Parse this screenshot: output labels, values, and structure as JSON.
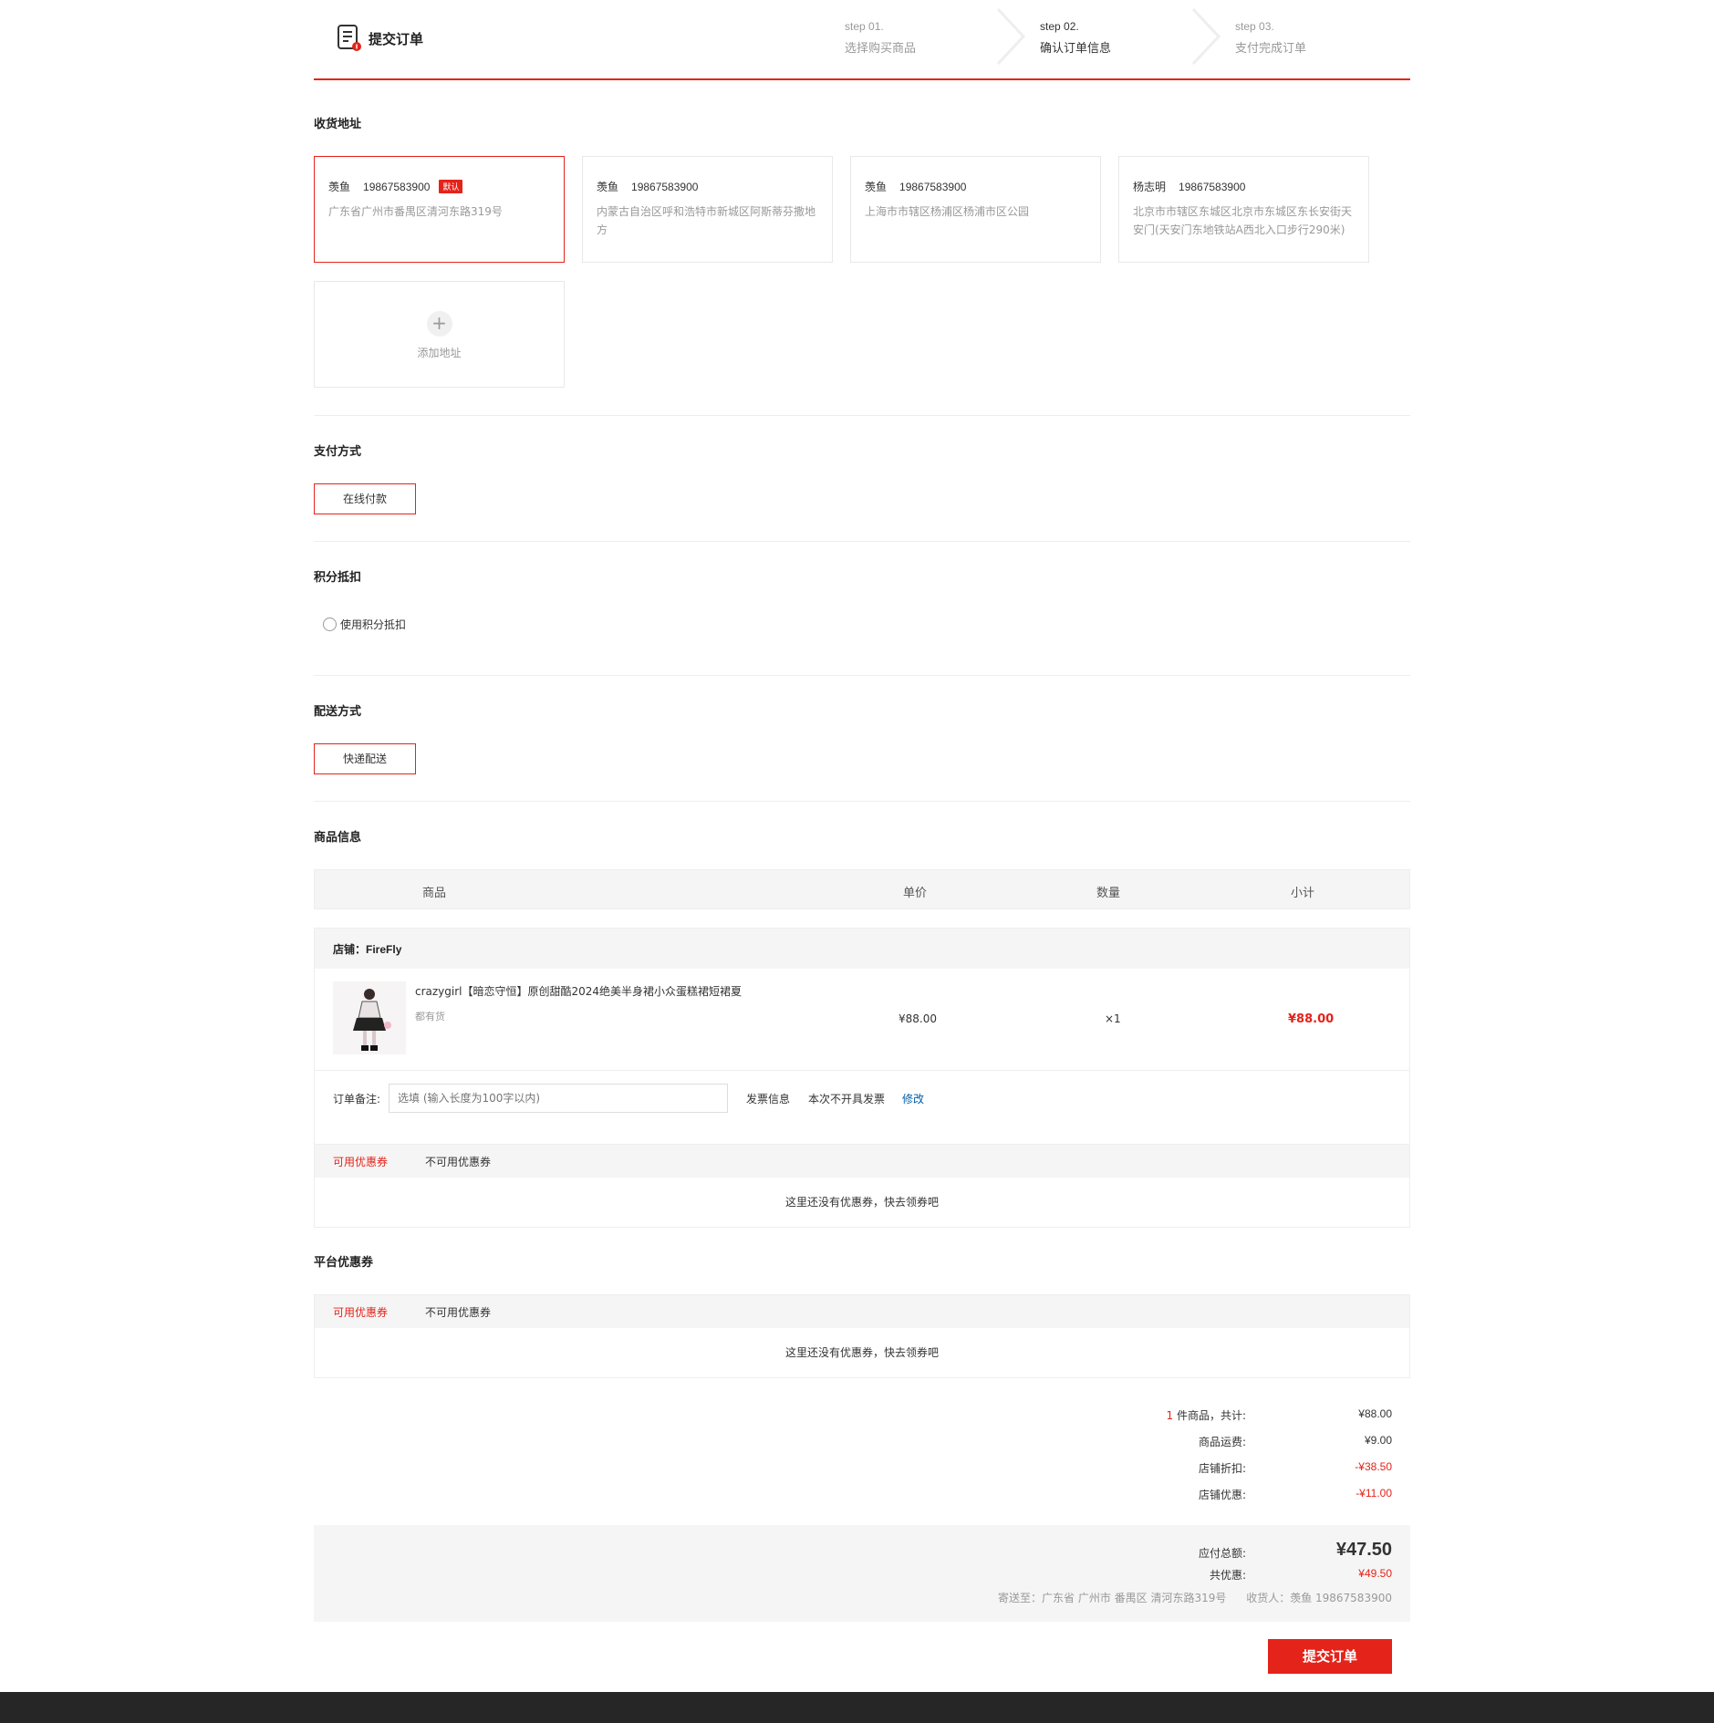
{
  "header": {
    "title": "提交订单",
    "steps": [
      {
        "num": "step 01.",
        "name": "选择购买商品"
      },
      {
        "num": "step 02.",
        "name": "确认订单信息"
      },
      {
        "num": "step 03.",
        "name": "支付完成订单"
      }
    ]
  },
  "address": {
    "title": "收货地址",
    "default_badge": "默认",
    "add_label": "添加地址",
    "cards": [
      {
        "name": "羡鱼",
        "phone": "19867583900",
        "detail": "广东省广州市番禺区清河东路319号"
      },
      {
        "name": "羡鱼",
        "phone": "19867583900",
        "detail": "内蒙古自治区呼和浩特市新城区阿斯蒂芬撒地方"
      },
      {
        "name": "羡鱼",
        "phone": "19867583900",
        "detail": "上海市市辖区杨浦区杨浦市区公园"
      },
      {
        "name": "杨志明",
        "phone": "19867583900",
        "detail": "北京市市辖区东城区北京市东城区东长安街天安门(天安门东地铁站A西北入口步行290米)"
      }
    ]
  },
  "payment": {
    "title": "支付方式",
    "option": "在线付款"
  },
  "points": {
    "title": "积分抵扣",
    "option": "使用积分抵扣"
  },
  "delivery": {
    "title": "配送方式",
    "option": "快递配送"
  },
  "goods": {
    "title": "商品信息",
    "columns": [
      "商品",
      "单价",
      "数量",
      "小计"
    ],
    "shop_label": "店铺：",
    "shop_name": "FireFly",
    "item": {
      "title": "crazygirl【暗恋守恒】原创甜酷2024绝美半身裙小众蛋糕裙短裙夏",
      "stock": "都有货",
      "price": "¥88.00",
      "qty": "×1",
      "subtotal": "¥88.00"
    },
    "remark_label": "订单备注:",
    "remark_placeholder": "选填 (输入长度为100字以内)",
    "invoice_label": "发票信息",
    "invoice_value": "本次不开具发票",
    "invoice_edit": "修改",
    "coupon_tabs": [
      "可用优惠券",
      "不可用优惠券"
    ],
    "coupon_empty": "这里还没有优惠券，快去领券吧"
  },
  "platform_coupon": {
    "title": "平台优惠券",
    "tabs": [
      "可用优惠券",
      "不可用优惠券"
    ],
    "empty": "这里还没有优惠券，快去领券吧"
  },
  "summary": {
    "count": "1",
    "count_label": " 件商品，共计:",
    "goods_total": "¥88.00",
    "freight_label": "商品运费:",
    "freight": "¥9.00",
    "discount_label": "店铺折扣:",
    "discount": "-¥38.50",
    "shop_coupon_label": "店铺优惠:",
    "shop_coupon": "-¥11.00",
    "payable_label": "应付总额:",
    "payable": "¥47.50",
    "saved_label": "共优惠:",
    "saved": "¥49.50",
    "ship_to": "寄送至：广东省 广州市 番禺区 清河东路319号",
    "receiver": "收货人：羡鱼 19867583900"
  },
  "submit_label": "提交订单",
  "colors": {
    "accent": "#e4231a",
    "link": "#005ea7",
    "footer": "#262626"
  }
}
